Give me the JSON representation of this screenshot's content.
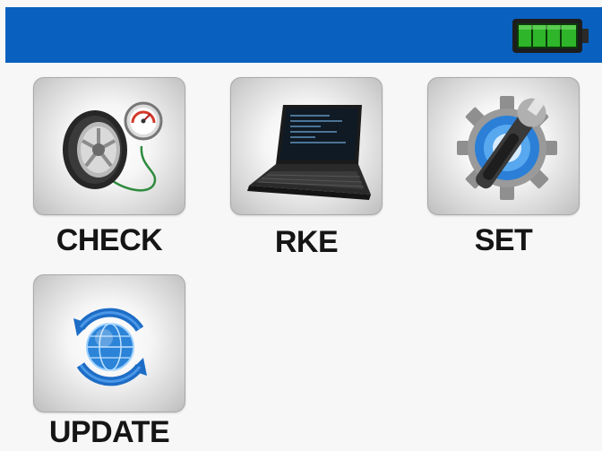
{
  "status_bar": {
    "battery_icon": "battery-full-icon",
    "bar_color": "#0a60bf",
    "battery_color": "#22a51f",
    "battery_level": 1.0
  },
  "menu": {
    "items": [
      {
        "label": "CHECK",
        "icon": "tire-pressure-icon"
      },
      {
        "label": "RKE",
        "icon": "laptop-icon"
      },
      {
        "label": "SET",
        "icon": "settings-gear-wrench-icon"
      },
      {
        "label": "UPDATE",
        "icon": "update-sync-icon"
      }
    ]
  }
}
